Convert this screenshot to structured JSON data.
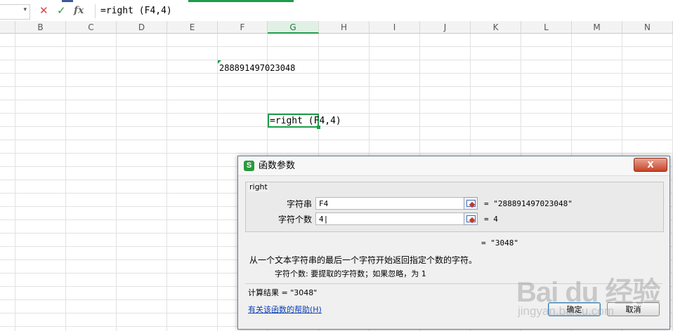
{
  "formula_bar": {
    "name_box_value": "",
    "cancel_icon": "x-icon",
    "confirm_icon": "check-icon",
    "fx_label": "fx",
    "formula": "=right (F4,4)"
  },
  "sheet": {
    "columns": [
      "B",
      "C",
      "D",
      "E",
      "F",
      "G",
      "H",
      "I",
      "J",
      "K",
      "L",
      "M",
      "N"
    ],
    "selected_column": "G",
    "cells": {
      "F4": "288891497023048",
      "G9": "=right (F4,4)"
    }
  },
  "dialog": {
    "title": "函数参数",
    "app_icon_letter": "S",
    "close_label": "X",
    "function_name": "right",
    "params": [
      {
        "label": "字符串",
        "value": "F4",
        "result": "= \"288891497023048\""
      },
      {
        "label": "字符个数",
        "value": "4|",
        "result": "= 4"
      }
    ],
    "overall_result": "= \"3048\"",
    "description": "从一个文本字符串的最后一个字符开始返回指定个数的字符。",
    "arg_description": "字符个数:  要提取的字符数；如果忽略，为 1",
    "calc_result": "计算结果 = \"3048\"",
    "help_link": "有关该函数的帮助(H)",
    "ok_label": "确定",
    "cancel_label": "取消"
  },
  "watermark": {
    "brand": "Bai du 经验",
    "url": "jingyan.baidu.com"
  }
}
